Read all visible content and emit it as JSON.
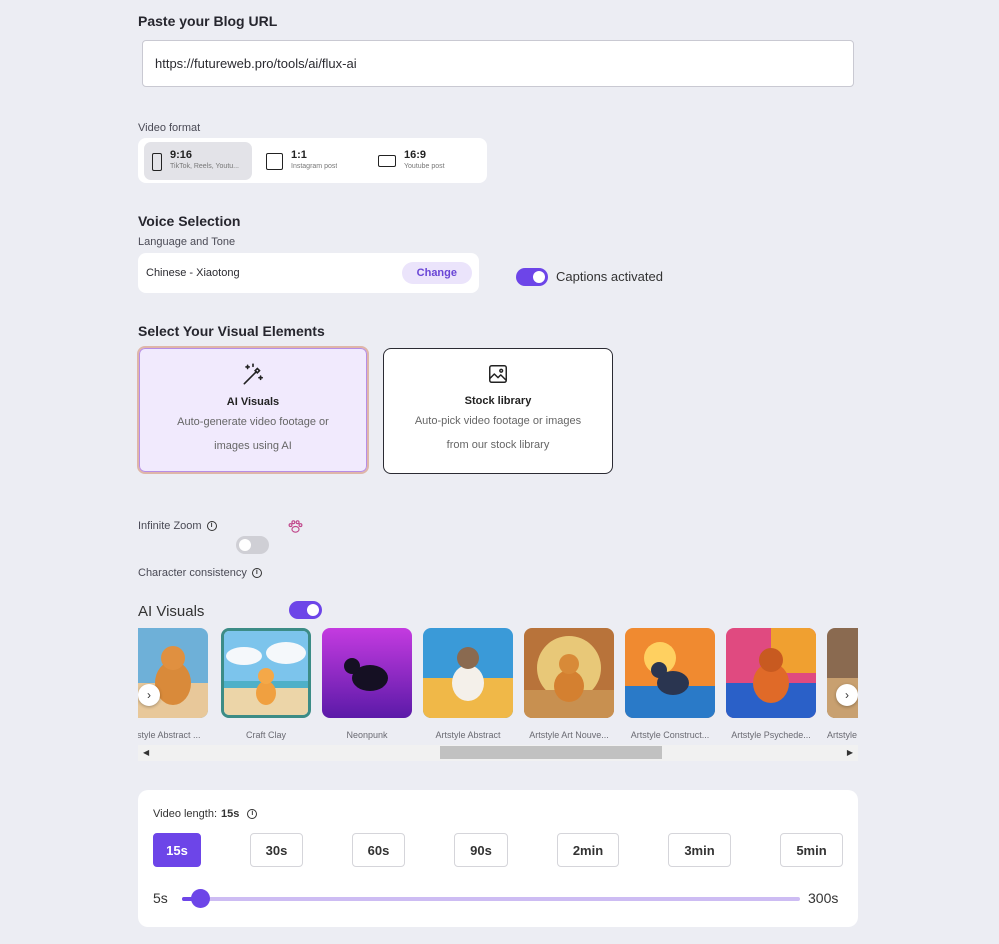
{
  "blog_url": {
    "heading": "Paste your Blog URL",
    "value": "https://futureweb.pro/tools/ai/flux-ai"
  },
  "video_format": {
    "label": "Video format",
    "options": [
      {
        "ratio": "9:16",
        "desc": "TikTok, Reels, Youtu...",
        "selected": true
      },
      {
        "ratio": "1:1",
        "desc": "Instagram post",
        "selected": false
      },
      {
        "ratio": "16:9",
        "desc": "Youtube post",
        "selected": false
      }
    ]
  },
  "voice": {
    "heading": "Voice Selection",
    "label": "Language and Tone",
    "selected_voice": "Chinese - Xiaotong",
    "change_label": "Change",
    "captions_label": "Captions activated",
    "captions_on": true
  },
  "visual_elements": {
    "heading": "Select Your Visual Elements",
    "ai": {
      "title": "AI Visuals",
      "desc": "Auto-generate video footage or images using AI",
      "icon": "magic-wand-icon"
    },
    "stock": {
      "title": "Stock library",
      "desc": "Auto-pick video footage or images from our stock library",
      "icon": "image-icon"
    }
  },
  "options": {
    "infinite_zoom_label": "Infinite Zoom",
    "infinite_zoom_on": false,
    "character_consistency_label": "Character consistency",
    "character_consistency_on": true
  },
  "ai_visuals": {
    "heading": "AI Visuals",
    "styles": [
      {
        "label": "Artstyle Abstract ...",
        "selected": false
      },
      {
        "label": "Craft Clay",
        "selected": true
      },
      {
        "label": "Neonpunk",
        "selected": false
      },
      {
        "label": "Artstyle Abstract",
        "selected": false
      },
      {
        "label": "Artstyle Art Nouve...",
        "selected": false
      },
      {
        "label": "Artstyle Construct...",
        "selected": false
      },
      {
        "label": "Artstyle Psychede...",
        "selected": false
      },
      {
        "label": "Artstyle",
        "selected": false
      }
    ]
  },
  "video_length": {
    "label_prefix": "Video length:",
    "current": "15s",
    "options": [
      "15s",
      "30s",
      "60s",
      "90s",
      "2min",
      "3min",
      "5min"
    ],
    "slider_min_label": "5s",
    "slider_max_label": "300s",
    "slider_fraction": 0.017
  },
  "colors": {
    "accent": "#6d45e8",
    "background": "#ecedf3"
  }
}
